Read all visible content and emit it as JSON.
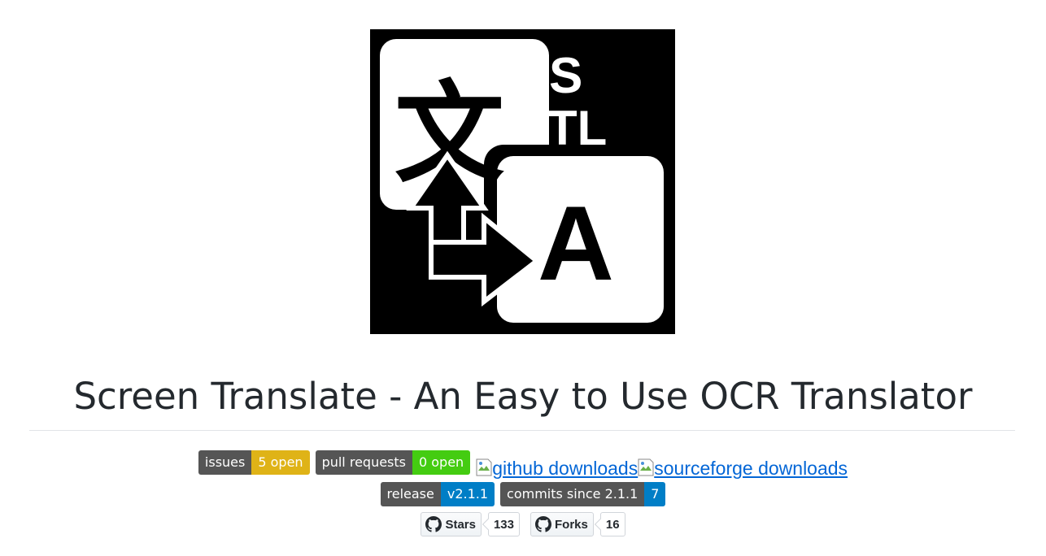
{
  "logo": {
    "alt": "Screen Translate logo",
    "letters_top": "S",
    "letters_mid": "TL",
    "letter_big": "A",
    "glyph": "文"
  },
  "title": "Screen Translate - An Easy to Use OCR Translator",
  "badges_row1": [
    {
      "label": "issues",
      "value": "5 open",
      "color": "#dfb317"
    },
    {
      "label": "pull requests",
      "value": "0 open",
      "color": "#4c1"
    }
  ],
  "image_links": [
    {
      "text": "github downloads"
    },
    {
      "text": "sourceforge downloads"
    }
  ],
  "badges_row2": [
    {
      "label": "release",
      "value": "v2.1.1",
      "color": "#007ec6"
    },
    {
      "label": "commits since 2.1.1",
      "value": "7",
      "color": "#007ec6"
    }
  ],
  "github_buttons": [
    {
      "label": "Stars",
      "count": "133",
      "icon": "github-icon"
    },
    {
      "label": "Forks",
      "count": "16",
      "icon": "github-icon"
    }
  ]
}
